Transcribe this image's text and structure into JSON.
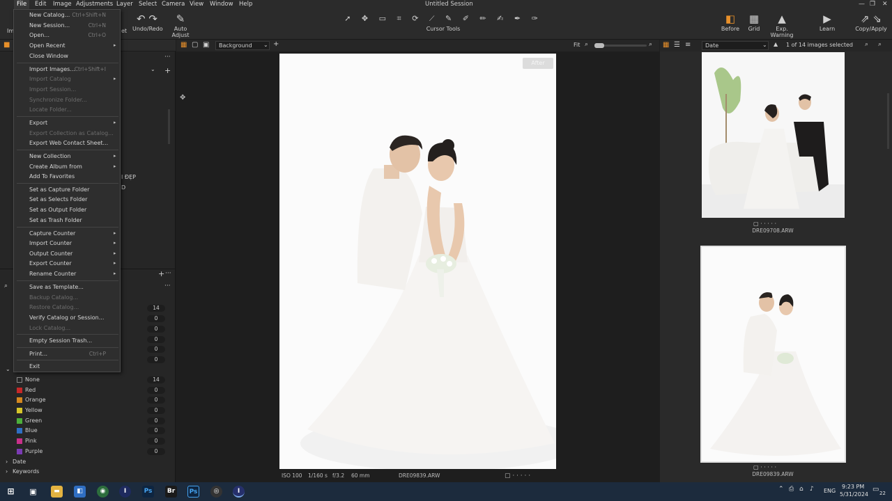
{
  "window": {
    "title": "Untitled Session",
    "menus": [
      "File",
      "Edit",
      "Image",
      "Adjustments",
      "Layer",
      "Select",
      "Camera",
      "View",
      "Window",
      "Help"
    ],
    "controls": [
      "—",
      "❐",
      "✕"
    ]
  },
  "toolbar": {
    "left_label_partial": "Im",
    "left_label_partial2": "et",
    "undo_redo": "Undo/Redo",
    "auto_adjust": "Auto Adjust",
    "cursor_tools": "Cursor Tools",
    "before": "Before",
    "grid": "Grid",
    "exp_warning": "Exp. Warning",
    "learn": "Learn",
    "copy_apply": "Copy/Apply"
  },
  "file_menu": {
    "items": [
      {
        "label": "New Catalog...",
        "shortcut": "Ctrl+Shift+N",
        "disabled": false,
        "submenu": false
      },
      {
        "label": "New Session...",
        "shortcut": "Ctrl+N",
        "disabled": false,
        "submenu": false
      },
      {
        "label": "Open...",
        "shortcut": "Ctrl+O",
        "disabled": false,
        "submenu": false
      },
      {
        "label": "Open Recent",
        "shortcut": "",
        "disabled": false,
        "submenu": true
      },
      {
        "label": "Close Window",
        "shortcut": "",
        "disabled": false,
        "submenu": false
      },
      {
        "label": "Import Images...",
        "shortcut": "Ctrl+Shift+I",
        "disabled": false,
        "submenu": false
      },
      {
        "label": "Import Catalog",
        "shortcut": "",
        "disabled": true,
        "submenu": true
      },
      {
        "label": "Import Session...",
        "shortcut": "",
        "disabled": true,
        "submenu": false
      },
      {
        "label": "Synchronize Folder...",
        "shortcut": "",
        "disabled": true,
        "submenu": false
      },
      {
        "label": "Locate Folder...",
        "shortcut": "",
        "disabled": true,
        "submenu": false
      },
      {
        "label": "Export",
        "shortcut": "",
        "disabled": false,
        "submenu": true
      },
      {
        "label": "Export Collection as Catalog...",
        "shortcut": "",
        "disabled": true,
        "submenu": false
      },
      {
        "label": "Export Web Contact Sheet...",
        "shortcut": "",
        "disabled": false,
        "submenu": false
      },
      {
        "label": "New Collection",
        "shortcut": "",
        "disabled": false,
        "submenu": true
      },
      {
        "label": "Create Album from",
        "shortcut": "",
        "disabled": false,
        "submenu": true
      },
      {
        "label": "Add To Favorites",
        "shortcut": "",
        "disabled": false,
        "submenu": false
      },
      {
        "label": "Set as Capture Folder",
        "shortcut": "",
        "disabled": false,
        "submenu": false
      },
      {
        "label": "Set as Selects Folder",
        "shortcut": "",
        "disabled": false,
        "submenu": false
      },
      {
        "label": "Set as Output Folder",
        "shortcut": "",
        "disabled": false,
        "submenu": false
      },
      {
        "label": "Set as Trash Folder",
        "shortcut": "",
        "disabled": false,
        "submenu": false
      },
      {
        "label": "Capture Counter",
        "shortcut": "",
        "disabled": false,
        "submenu": true
      },
      {
        "label": "Import Counter",
        "shortcut": "",
        "disabled": false,
        "submenu": true
      },
      {
        "label": "Output Counter",
        "shortcut": "",
        "disabled": false,
        "submenu": true
      },
      {
        "label": "Export Counter",
        "shortcut": "",
        "disabled": false,
        "submenu": true
      },
      {
        "label": "Rename Counter",
        "shortcut": "",
        "disabled": false,
        "submenu": true
      },
      {
        "label": "Save as Template...",
        "shortcut": "",
        "disabled": false,
        "submenu": false
      },
      {
        "label": "Backup Catalog...",
        "shortcut": "",
        "disabled": true,
        "submenu": false
      },
      {
        "label": "Restore Catalog...",
        "shortcut": "",
        "disabled": true,
        "submenu": false
      },
      {
        "label": "Verify Catalog or Session...",
        "shortcut": "",
        "disabled": false,
        "submenu": false
      },
      {
        "label": "Lock Catalog...",
        "shortcut": "",
        "disabled": true,
        "submenu": false
      },
      {
        "label": "Empty Session Trash...",
        "shortcut": "",
        "disabled": false,
        "submenu": false
      },
      {
        "label": "Print...",
        "shortcut": "Ctrl+P",
        "disabled": false,
        "submenu": false
      },
      {
        "label": "Exit",
        "shortcut": "",
        "disabled": false,
        "submenu": false
      }
    ]
  },
  "left_panel": {
    "partial_text_1": "I ĐẸP",
    "partial_text_2": "D",
    "rating_counts": [
      "14",
      "0",
      "0",
      "0",
      "0",
      "0"
    ],
    "color_tags": [
      {
        "label": "None",
        "count": "14",
        "color": "#1e1e1e"
      },
      {
        "label": "Red",
        "count": "0",
        "color": "#c62828"
      },
      {
        "label": "Orange",
        "count": "0",
        "color": "#d4881f"
      },
      {
        "label": "Yellow",
        "count": "0",
        "color": "#d6c52a"
      },
      {
        "label": "Green",
        "count": "0",
        "color": "#4caf3a"
      },
      {
        "label": "Blue",
        "count": "0",
        "color": "#2f6fc4"
      },
      {
        "label": "Pink",
        "count": "0",
        "color": "#c8308a"
      },
      {
        "label": "Purple",
        "count": "0",
        "color": "#7b3bb4"
      }
    ],
    "date_label": "Date",
    "keywords_label": "Keywords"
  },
  "viewer": {
    "background_label": "Background",
    "fit_label": "Fit",
    "after_badge": "After",
    "iso": "ISO 100",
    "shutter": "1/160 s",
    "aperture": "f/3.2",
    "focal": "60 mm",
    "filename": "DRE09839.ARW"
  },
  "browser": {
    "sort_label": "Date",
    "selection_status": "1 of 14 images selected",
    "thumbs": [
      {
        "name": "DRE09708.ARW"
      },
      {
        "name": "DRE09839.ARW"
      }
    ]
  },
  "taskbar": {
    "lang": "ENG",
    "time": "9:23 PM",
    "date": "5/31/2024",
    "notifications": "22"
  }
}
